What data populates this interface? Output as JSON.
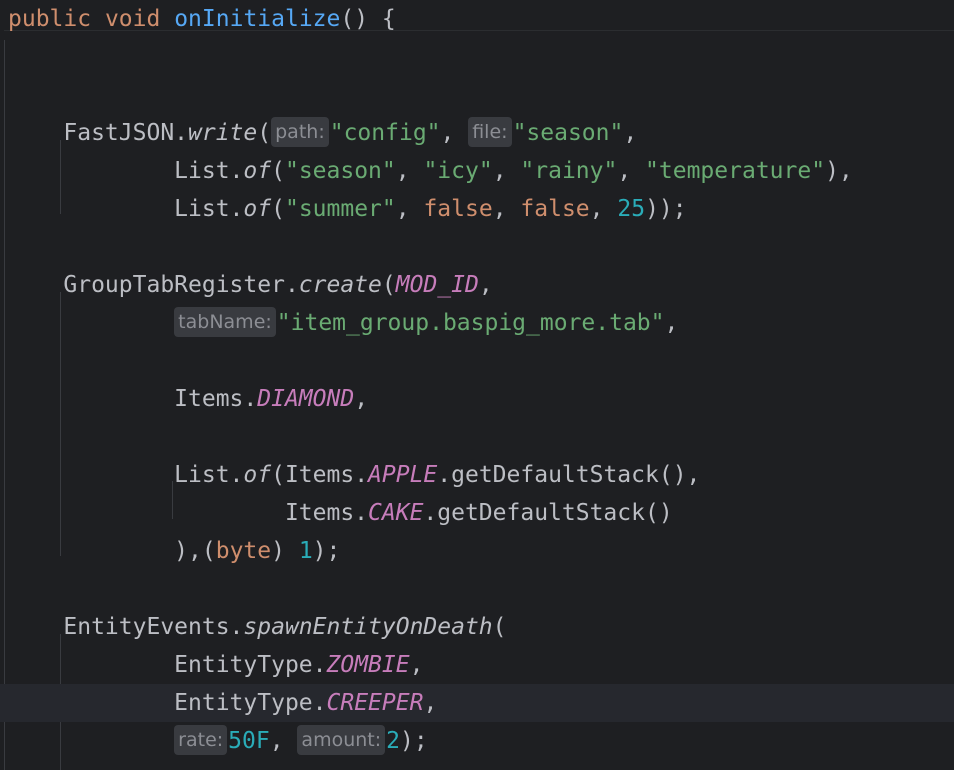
{
  "colors": {
    "background": "#1e1f22",
    "current_line": "#26282e",
    "keyword": "#cf8e6d",
    "function_declaration": "#56a8f5",
    "default_text": "#bcbec4",
    "string": "#6aab73",
    "number": "#2aacb8",
    "constant": "#c77dbb",
    "inlay_hint_text": "#8c8e94",
    "inlay_hint_background": "#393b40"
  },
  "editor": {
    "language": "java",
    "caret_line": 18,
    "lines": [
      {
        "tokens": [
          {
            "t": "keyword",
            "v": "public"
          },
          {
            "t": "plain",
            "v": " "
          },
          {
            "t": "keyword",
            "v": "void"
          },
          {
            "t": "plain",
            "v": " "
          },
          {
            "t": "fn-decl",
            "v": "onInitialize"
          },
          {
            "t": "plain",
            "v": "() {"
          }
        ]
      },
      {
        "tokens": []
      },
      {
        "tokens": []
      },
      {
        "tokens": [
          {
            "t": "plain",
            "v": "    FastJSON."
          },
          {
            "t": "static-call",
            "v": "write"
          },
          {
            "t": "plain",
            "v": "("
          },
          {
            "t": "hint",
            "v": "path:"
          },
          {
            "t": "string",
            "v": "\"config\""
          },
          {
            "t": "plain",
            "v": ", "
          },
          {
            "t": "hint",
            "v": "file:"
          },
          {
            "t": "string",
            "v": "\"season\""
          },
          {
            "t": "plain",
            "v": ","
          }
        ]
      },
      {
        "tokens": [
          {
            "t": "plain",
            "v": "            List."
          },
          {
            "t": "static-call",
            "v": "of"
          },
          {
            "t": "plain",
            "v": "("
          },
          {
            "t": "string",
            "v": "\"season\""
          },
          {
            "t": "plain",
            "v": ", "
          },
          {
            "t": "string",
            "v": "\"icy\""
          },
          {
            "t": "plain",
            "v": ", "
          },
          {
            "t": "string",
            "v": "\"rainy\""
          },
          {
            "t": "plain",
            "v": ", "
          },
          {
            "t": "string",
            "v": "\"temperature\""
          },
          {
            "t": "plain",
            "v": "),"
          }
        ]
      },
      {
        "tokens": [
          {
            "t": "plain",
            "v": "            List."
          },
          {
            "t": "static-call",
            "v": "of"
          },
          {
            "t": "plain",
            "v": "("
          },
          {
            "t": "string",
            "v": "\"summer\""
          },
          {
            "t": "plain",
            "v": ", "
          },
          {
            "t": "keyword",
            "v": "false"
          },
          {
            "t": "plain",
            "v": ", "
          },
          {
            "t": "keyword",
            "v": "false"
          },
          {
            "t": "plain",
            "v": ", "
          },
          {
            "t": "number",
            "v": "25"
          },
          {
            "t": "plain",
            "v": "));"
          }
        ]
      },
      {
        "tokens": []
      },
      {
        "tokens": [
          {
            "t": "plain",
            "v": "    GroupTabRegister."
          },
          {
            "t": "static-call",
            "v": "create"
          },
          {
            "t": "plain",
            "v": "("
          },
          {
            "t": "constant",
            "v": "MOD_ID"
          },
          {
            "t": "plain",
            "v": ","
          }
        ]
      },
      {
        "tokens": [
          {
            "t": "plain",
            "v": "            "
          },
          {
            "t": "hint",
            "v": "tabName:"
          },
          {
            "t": "string",
            "v": "\"item_group.baspig_more.tab\""
          },
          {
            "t": "plain",
            "v": ","
          }
        ]
      },
      {
        "tokens": []
      },
      {
        "tokens": [
          {
            "t": "plain",
            "v": "            Items."
          },
          {
            "t": "constant",
            "v": "DIAMOND"
          },
          {
            "t": "plain",
            "v": ","
          }
        ]
      },
      {
        "tokens": []
      },
      {
        "tokens": [
          {
            "t": "plain",
            "v": "            List."
          },
          {
            "t": "static-call",
            "v": "of"
          },
          {
            "t": "plain",
            "v": "(Items."
          },
          {
            "t": "constant",
            "v": "APPLE"
          },
          {
            "t": "plain",
            "v": ".getDefaultStack(),"
          }
        ]
      },
      {
        "tokens": [
          {
            "t": "plain",
            "v": "                    Items."
          },
          {
            "t": "constant",
            "v": "CAKE"
          },
          {
            "t": "plain",
            "v": ".getDefaultStack()"
          }
        ]
      },
      {
        "tokens": [
          {
            "t": "plain",
            "v": "            ),("
          },
          {
            "t": "keyword",
            "v": "byte"
          },
          {
            "t": "plain",
            "v": ") "
          },
          {
            "t": "number",
            "v": "1"
          },
          {
            "t": "plain",
            "v": ");"
          }
        ]
      },
      {
        "tokens": []
      },
      {
        "tokens": [
          {
            "t": "plain",
            "v": "    EntityEvents."
          },
          {
            "t": "static-call",
            "v": "spawnEntityOnDeath"
          },
          {
            "t": "plain",
            "v": "("
          }
        ]
      },
      {
        "tokens": [
          {
            "t": "plain",
            "v": "            EntityType."
          },
          {
            "t": "constant",
            "v": "ZOMBIE"
          },
          {
            "t": "plain",
            "v": ","
          }
        ]
      },
      {
        "tokens": [
          {
            "t": "plain",
            "v": "            EntityType."
          },
          {
            "t": "constant",
            "v": "CREEPER"
          },
          {
            "t": "plain",
            "v": ","
          }
        ]
      },
      {
        "tokens": [
          {
            "t": "plain",
            "v": "            "
          },
          {
            "t": "hint",
            "v": "rate:"
          },
          {
            "t": "number",
            "v": "50F"
          },
          {
            "t": "plain",
            "v": ", "
          },
          {
            "t": "hint",
            "v": "amount:"
          },
          {
            "t": "number",
            "v": "2"
          },
          {
            "t": "plain",
            "v": ");"
          }
        ]
      }
    ]
  }
}
